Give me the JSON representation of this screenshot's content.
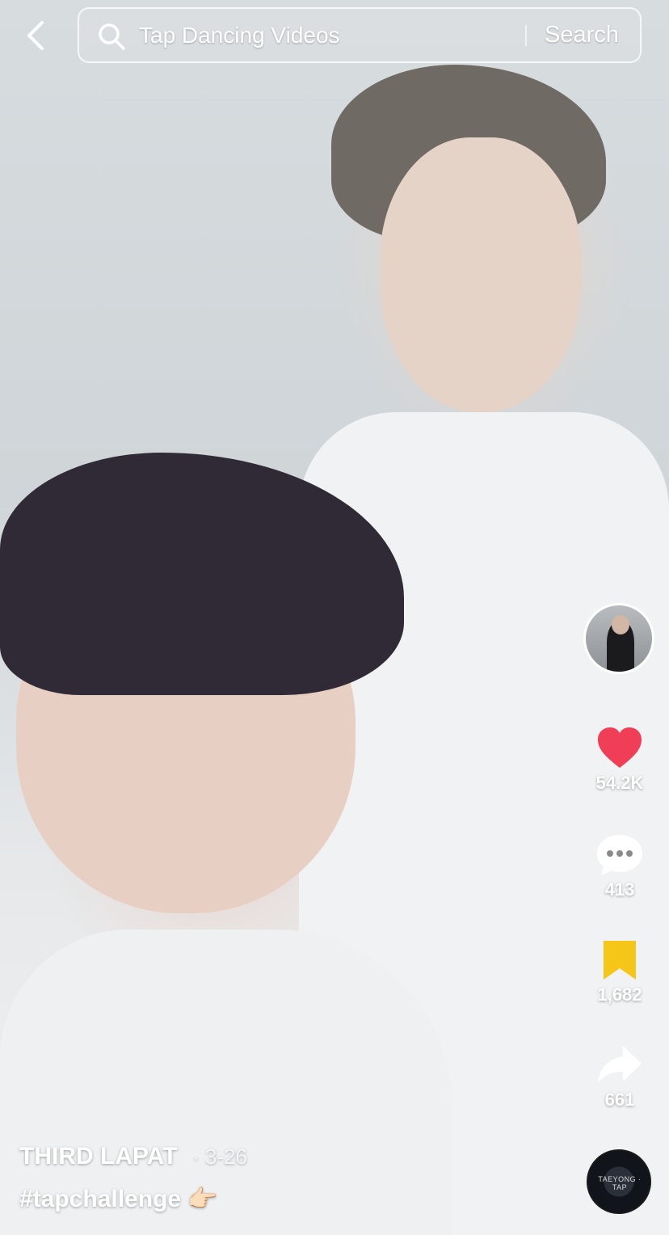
{
  "search": {
    "query": "Tap Dancing Videos",
    "button_label": "Search"
  },
  "actions": {
    "likes": "54.2K",
    "comments": "413",
    "saves": "1,682",
    "shares": "661"
  },
  "caption": {
    "author": "THIRD LAPAT",
    "date": "· 3-26",
    "text": "#tapchallenge 👉🏻"
  },
  "music_disc": {
    "label": "TAEYONG · TAP"
  },
  "colors": {
    "like": "#ef3e55",
    "save": "#f5c518",
    "text": "#ffffff"
  },
  "icons": [
    "back-arrow-icon",
    "search-icon",
    "heart-icon",
    "comment-icon",
    "bookmark-icon",
    "share-icon"
  ]
}
